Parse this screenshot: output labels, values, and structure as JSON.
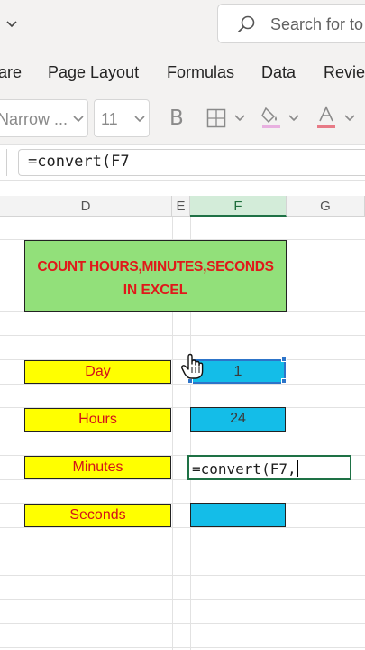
{
  "search": {
    "placeholder": "Search for to"
  },
  "ribbon": {
    "tabs": [
      {
        "label": "are"
      },
      {
        "label": "Page Layout"
      },
      {
        "label": "Formulas"
      },
      {
        "label": "Data"
      },
      {
        "label": "Reviev"
      }
    ]
  },
  "toolbar": {
    "font_name": "Narrow ...",
    "font_size": "11",
    "bold_label": "B"
  },
  "formula_bar": {
    "value": "=convert(F7"
  },
  "columns": [
    {
      "label": "D"
    },
    {
      "label": "E"
    },
    {
      "label": "F"
    },
    {
      "label": "G"
    }
  ],
  "sheet": {
    "title_line1": "COUNT HOURS,MINUTES,SECONDS",
    "title_line2": "IN EXCEL",
    "rows": [
      {
        "label": "Day",
        "value": "1"
      },
      {
        "label": "Hours",
        "value": "24"
      },
      {
        "label": "Minutes",
        "value": ""
      },
      {
        "label": "Seconds",
        "value": ""
      }
    ],
    "editing_text": "=convert(F7,"
  },
  "colors": {
    "title_fill": "#92e07a",
    "title_text": "#e0191a",
    "label_fill": "#ffff00",
    "value_fill": "#14bde8",
    "selection": "#1e7145"
  }
}
